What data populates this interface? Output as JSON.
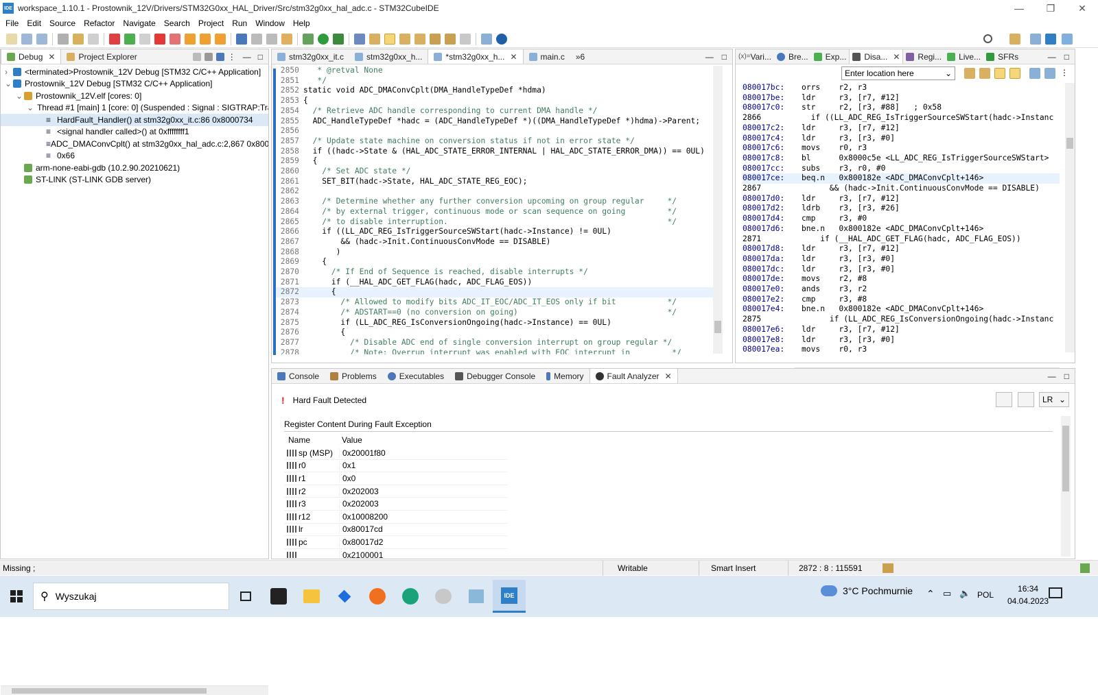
{
  "window": {
    "title": "workspace_1.10.1 - Prostownik_12V/Drivers/STM32G0xx_HAL_Driver/Src/stm32g0xx_hal_adc.c - STM32CubeIDE",
    "logo": "IDE"
  },
  "menu": [
    "File",
    "Edit",
    "Source",
    "Refactor",
    "Navigate",
    "Search",
    "Project",
    "Run",
    "Window",
    "Help"
  ],
  "debug_panel": {
    "tabs": [
      {
        "label": "Debug"
      },
      {
        "label": "Project Explorer"
      }
    ],
    "tree": [
      {
        "text": "<terminated>Prostownik_12V Debug [STM32 C/C++ Application]",
        "level": 0
      },
      {
        "text": "Prostownik_12V Debug [STM32 C/C++ Application]",
        "level": 0
      },
      {
        "text": "Prostownik_12V.elf [cores: 0]",
        "level": 1
      },
      {
        "text": "Thread #1 [main] 1 [core: 0] (Suspended : Signal : SIGTRAP:Tra",
        "level": 2
      },
      {
        "text": "HardFault_Handler() at stm32g0xx_it.c:86 0x8000734",
        "level": 3
      },
      {
        "text": "<signal handler called>() at 0xffffffff1",
        "level": 3
      },
      {
        "text": "ADC_DMAConvCplt() at stm32g0xx_hal_adc.c:2,867 0x8001",
        "level": 3
      },
      {
        "text": "0x66",
        "level": 3
      },
      {
        "text": "arm-none-eabi-gdb (10.2.90.20210621)",
        "level": 1
      },
      {
        "text": "ST-LINK (ST-LINK GDB server)",
        "level": 1
      }
    ]
  },
  "editor": {
    "tabs": [
      {
        "label": "stm32g0xx_it.c"
      },
      {
        "label": "stm32g0xx_h..."
      },
      {
        "label": "*stm32g0xx_h..."
      },
      {
        "label": "main.c"
      },
      {
        "label": "»6"
      }
    ],
    "lines": [
      {
        "n": "2850",
        "t": "   * @retval None"
      },
      {
        "n": "2851",
        "t": "   */"
      },
      {
        "n": "2852",
        "t": "static void ADC_DMAConvCplt(DMA_HandleTypeDef *hdma)"
      },
      {
        "n": "2853",
        "t": "{"
      },
      {
        "n": "2854",
        "t": "  /* Retrieve ADC handle corresponding to current DMA handle */"
      },
      {
        "n": "2855",
        "t": "  ADC_HandleTypeDef *hadc = (ADC_HandleTypeDef *)((DMA_HandleTypeDef *)hdma)->Parent;"
      },
      {
        "n": "2856",
        "t": ""
      },
      {
        "n": "2857",
        "t": "  /* Update state machine on conversion status if not in error state */"
      },
      {
        "n": "2858",
        "t": "  if ((hadc->State & (HAL_ADC_STATE_ERROR_INTERNAL | HAL_ADC_STATE_ERROR_DMA)) == 0UL)"
      },
      {
        "n": "2859",
        "t": "  {"
      },
      {
        "n": "2860",
        "t": "    /* Set ADC state */"
      },
      {
        "n": "2861",
        "t": "    SET_BIT(hadc->State, HAL_ADC_STATE_REG_EOC);"
      },
      {
        "n": "2862",
        "t": ""
      },
      {
        "n": "2863",
        "t": "    /* Determine whether any further conversion upcoming on group regular     */"
      },
      {
        "n": "2864",
        "t": "    /* by external trigger, continuous mode or scan sequence on going         */"
      },
      {
        "n": "2865",
        "t": "    /* to disable interruption.                                               */"
      },
      {
        "n": "2866",
        "t": "    if ((LL_ADC_REG_IsTriggerSourceSWStart(hadc->Instance) != 0UL)"
      },
      {
        "n": "2867",
        "t": "        && (hadc->Init.ContinuousConvMode == DISABLE)"
      },
      {
        "n": "2868",
        "t": "       )"
      },
      {
        "n": "2869",
        "t": "    {"
      },
      {
        "n": "2870",
        "t": "      /* If End of Sequence is reached, disable interrupts */"
      },
      {
        "n": "2871",
        "t": "      if (__HAL_ADC_GET_FLAG(hadc, ADC_FLAG_EOS))"
      },
      {
        "n": "2872",
        "t": "      {"
      },
      {
        "n": "2873",
        "t": "        /* Allowed to modify bits ADC_IT_EOC/ADC_IT_EOS only if bit           */"
      },
      {
        "n": "2874",
        "t": "        /* ADSTART==0 (no conversion on going)                                */"
      },
      {
        "n": "2875",
        "t": "        if (LL_ADC_REG_IsConversionOngoing(hadc->Instance) == 0UL)"
      },
      {
        "n": "2876",
        "t": "        {"
      },
      {
        "n": "2877",
        "t": "          /* Disable ADC end of single conversion interrupt on group regular */"
      },
      {
        "n": "2878",
        "t": "          /* Note: Overrun interrupt was enabled with EOC interrupt in         */"
      }
    ]
  },
  "disasm": {
    "tabs": [
      {
        "label": "Vari..."
      },
      {
        "label": "Bre..."
      },
      {
        "label": "Exp..."
      },
      {
        "label": "Disa..."
      },
      {
        "label": "Regi..."
      },
      {
        "label": "Live..."
      },
      {
        "label": "SFRs"
      }
    ],
    "tab_prefix": "(x)=",
    "location_placeholder": "Enter location here",
    "lines": [
      {
        "a": "080017bc:",
        "t": "orrs    r2, r3"
      },
      {
        "a": "080017be:",
        "t": "ldr     r3, [r7, #12]"
      },
      {
        "a": "080017c0:",
        "t": "str     r2, [r3, #88]   ; 0x58"
      },
      {
        "a": "2866",
        "t": "  if ((LL_ADC_REG_IsTriggerSourceSWStart(hadc->Instanc"
      },
      {
        "a": "080017c2:",
        "t": "ldr     r3, [r7, #12]"
      },
      {
        "a": "080017c4:",
        "t": "ldr     r3, [r3, #0]"
      },
      {
        "a": "080017c6:",
        "t": "movs    r0, r3"
      },
      {
        "a": "080017c8:",
        "t": "bl      0x8000c5e <LL_ADC_REG_IsTriggerSourceSWStart>"
      },
      {
        "a": "080017cc:",
        "t": "subs    r3, r0, #0"
      },
      {
        "a": "080017ce:",
        "t": "beq.n   0x800182e <ADC_DMAConvCplt+146>"
      },
      {
        "a": "2867",
        "t": "      && (hadc->Init.ContinuousConvMode == DISABLE)"
      },
      {
        "a": "080017d0:",
        "t": "ldr     r3, [r7, #12]"
      },
      {
        "a": "080017d2:",
        "t": "ldrb    r3, [r3, #26]"
      },
      {
        "a": "080017d4:",
        "t": "cmp     r3, #0"
      },
      {
        "a": "080017d6:",
        "t": "bne.n   0x800182e <ADC_DMAConvCplt+146>"
      },
      {
        "a": "2871",
        "t": "    if (__HAL_ADC_GET_FLAG(hadc, ADC_FLAG_EOS))"
      },
      {
        "a": "080017d8:",
        "t": "ldr     r3, [r7, #12]"
      },
      {
        "a": "080017da:",
        "t": "ldr     r3, [r3, #0]"
      },
      {
        "a": "080017dc:",
        "t": "ldr     r3, [r3, #0]"
      },
      {
        "a": "080017de:",
        "t": "movs    r2, #8"
      },
      {
        "a": "080017e0:",
        "t": "ands    r3, r2"
      },
      {
        "a": "080017e2:",
        "t": "cmp     r3, #8"
      },
      {
        "a": "080017e4:",
        "t": "bne.n   0x800182e <ADC_DMAConvCplt+146>"
      },
      {
        "a": "2875",
        "t": "      if (LL_ADC_REG_IsConversionOngoing(hadc->Instanc"
      },
      {
        "a": "080017e6:",
        "t": "ldr     r3, [r7, #12]"
      },
      {
        "a": "080017e8:",
        "t": "ldr     r3, [r3, #0]"
      },
      {
        "a": "080017ea:",
        "t": "movs    r0, r3"
      }
    ]
  },
  "bottom": {
    "tabs": [
      {
        "label": "Console"
      },
      {
        "label": "Problems"
      },
      {
        "label": "Executables"
      },
      {
        "label": "Debugger Console"
      },
      {
        "label": "Memory"
      },
      {
        "label": "Fault Analyzer"
      }
    ],
    "fault_title": "Hard Fault Detected",
    "register_group": "Register Content During Fault Exception",
    "columns": [
      "Name",
      "Value"
    ],
    "dropdown": "LR",
    "registers": [
      {
        "name": "sp (MSP)",
        "value": "0x20001f80"
      },
      {
        "name": "r0",
        "value": "0x1"
      },
      {
        "name": "r1",
        "value": "0x0"
      },
      {
        "name": "r2",
        "value": "0x202003"
      },
      {
        "name": "r3",
        "value": "0x202003"
      },
      {
        "name": "r12",
        "value": "0x10008200"
      },
      {
        "name": "lr",
        "value": "0x80017cd"
      },
      {
        "name": "pc",
        "value": "0x80017d2"
      },
      {
        "name": "",
        "value": "0x2100001"
      }
    ]
  },
  "status": {
    "left": "Missing ;",
    "writable": "Writable",
    "insert": "Smart Insert",
    "position": "2872 : 8 : 115591"
  },
  "taskbar": {
    "search": "Wyszukaj",
    "weather": "3°C  Pochmurnie",
    "lang": "POL",
    "time": "16:34",
    "date": "04.04.2023"
  },
  "colors": {
    "accent": "#2f7ec8",
    "breakpoint": "#d0e4fb",
    "selection": "#dbe8f6",
    "error": "#e02020"
  }
}
